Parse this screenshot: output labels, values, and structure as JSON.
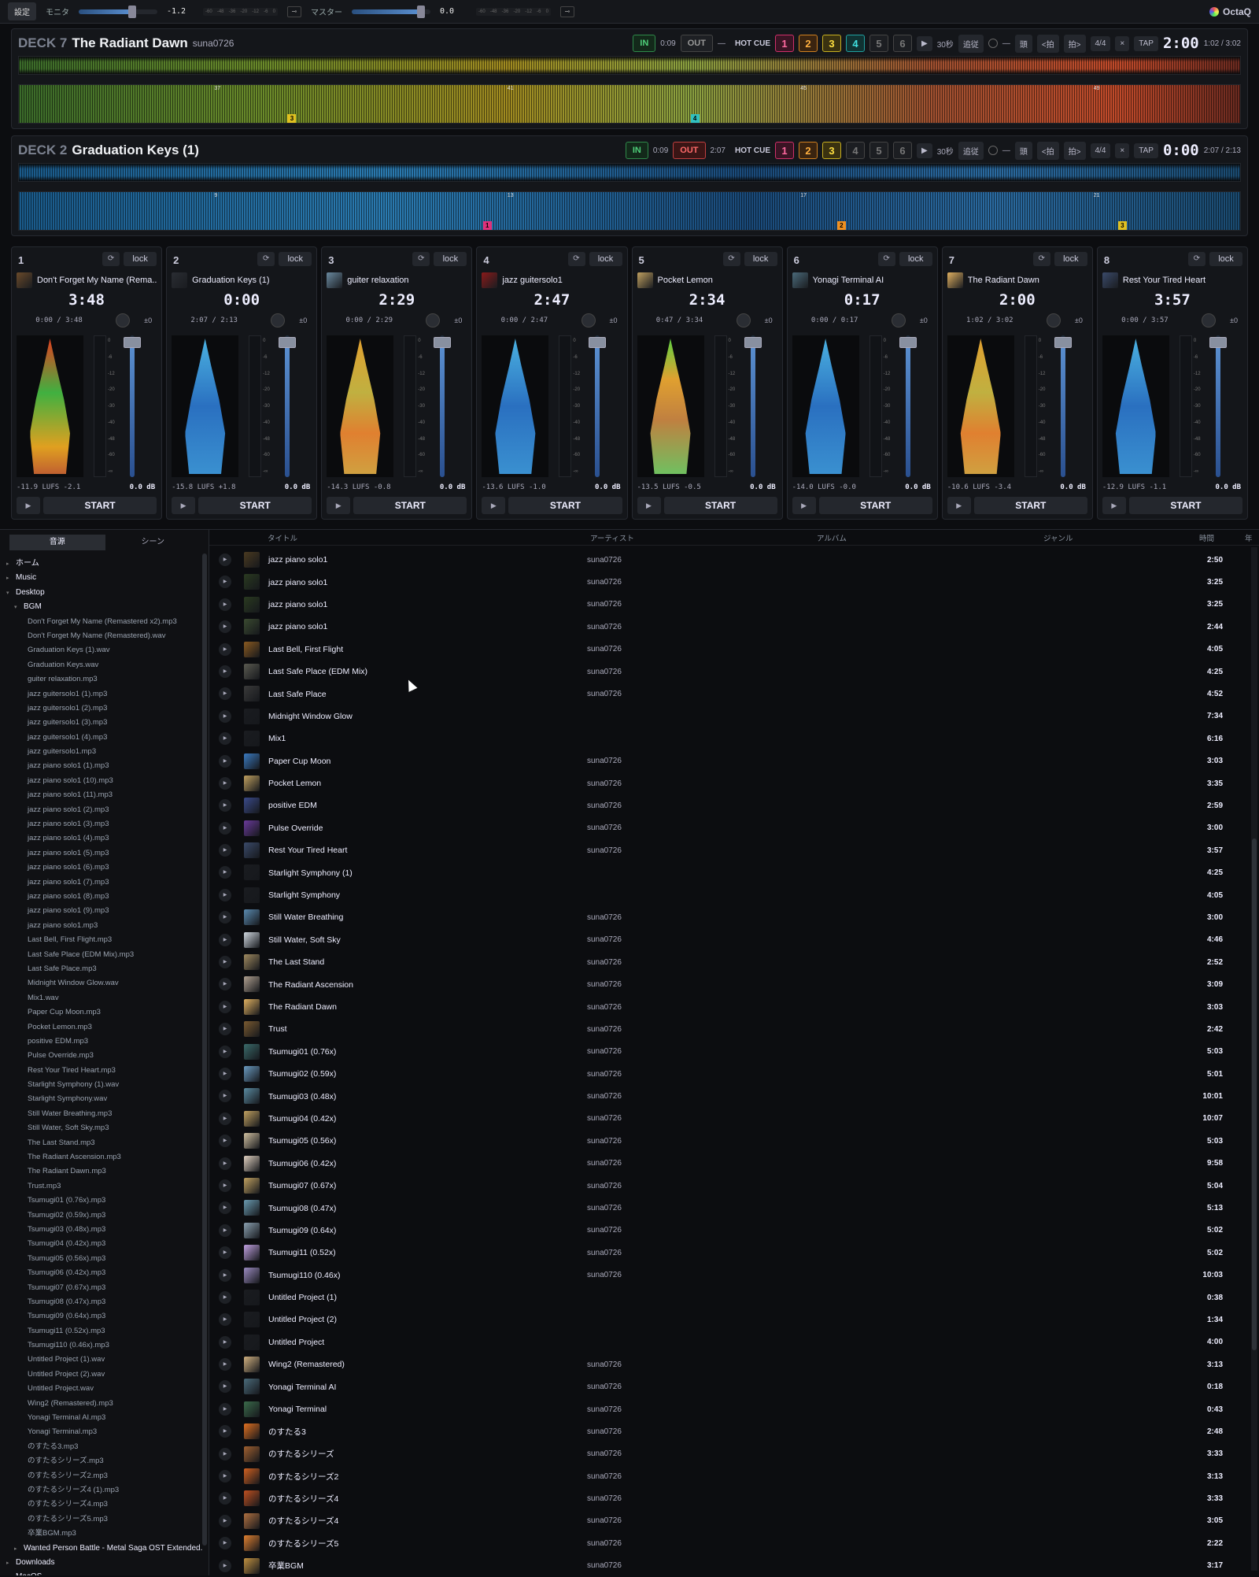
{
  "topbar": {
    "settings_label": "設定",
    "monitor_label": "モニタ",
    "monitor_value": "-1.2",
    "monitor_level": 0.68,
    "master_label": "マスター",
    "master_value": "0.0",
    "master_level": 0.88,
    "scale": [
      "-60",
      "-48",
      "-36",
      "-20",
      "-12",
      "-6",
      "0"
    ],
    "brand": "OctaQ"
  },
  "decks": [
    {
      "label": "DECK 7",
      "title": "The Radiant Dawn",
      "artist": "suna0726",
      "in_label": "IN",
      "in_time": "0:09",
      "out_label": "OUT",
      "out_active": false,
      "out_time": "",
      "dash": "—",
      "hotcue_label": "HOT CUE",
      "hotcues": [
        "1",
        "2",
        "3",
        "4",
        "5",
        "6"
      ],
      "hotcue_active": [
        true,
        true,
        true,
        true,
        false,
        false
      ],
      "play_icon": "▶",
      "skip_label": "30秒",
      "follow_label": "追従",
      "loop_dash": "—",
      "beat_label": "頭",
      "beat_back": "<拍",
      "beat_fwd": "拍>",
      "meter": "4/4",
      "close": "×",
      "tap": "TAP",
      "time": "2:00",
      "pos": "1:02 / 3:02",
      "palette": "warm",
      "cue_marks": [
        {
          "label": "3",
          "pos": 0.22,
          "color": "#e0c020"
        },
        {
          "label": "4",
          "pos": 0.55,
          "color": "#30c0c0"
        }
      ],
      "beat_numbers": [
        "37",
        "41",
        "45",
        "49"
      ]
    },
    {
      "label": "DECK 2",
      "title": "Graduation Keys (1)",
      "artist": "",
      "in_label": "IN",
      "in_time": "0:09",
      "out_label": "OUT",
      "out_active": true,
      "out_time": "2:07",
      "dash": "",
      "hotcue_label": "HOT CUE",
      "hotcues": [
        "1",
        "2",
        "3",
        "4",
        "5",
        "6"
      ],
      "hotcue_active": [
        true,
        true,
        true,
        false,
        false,
        false
      ],
      "play_icon": "▶",
      "skip_label": "30秒",
      "follow_label": "追従",
      "loop_dash": "—",
      "beat_label": "頭",
      "beat_back": "<拍",
      "beat_fwd": "拍>",
      "meter": "4/4",
      "close": "×",
      "tap": "TAP",
      "time": "0:00",
      "pos": "2:07 / 2:13",
      "palette": "cool",
      "cue_marks": [
        {
          "label": "1",
          "pos": 0.38,
          "color": "#e0307a"
        },
        {
          "label": "2",
          "pos": 0.67,
          "color": "#f09020"
        },
        {
          "label": "3",
          "pos": 0.9,
          "color": "#e0c020"
        }
      ],
      "beat_numbers": [
        "9",
        "13",
        "17",
        "21"
      ]
    }
  ],
  "channels": [
    {
      "num": "1",
      "sync": "⟳",
      "lock": "lock",
      "title": "Don't Forget My Name (Rema...",
      "time": "3:48",
      "pos": "0:00 / 3:48",
      "pm": "±0",
      "lufs": "-11.9 LUFS -2.1",
      "db": "0.0 dB",
      "play": "▶",
      "start": "START",
      "wave": "g",
      "thumb": "#6a4a2a"
    },
    {
      "num": "2",
      "sync": "⟳",
      "lock": "lock",
      "title": "Graduation Keys (1)",
      "time": "0:00",
      "pos": "2:07 / 2:13",
      "pm": "±0",
      "lufs": "-15.8 LUFS +1.8",
      "db": "0.0 dB",
      "play": "▶",
      "start": "START",
      "wave": "b",
      "thumb": "#2a2d33"
    },
    {
      "num": "3",
      "sync": "⟳",
      "lock": "lock",
      "title": "guiter relaxation",
      "time": "2:29",
      "pos": "0:00 / 2:29",
      "pm": "±0",
      "lufs": "-14.3 LUFS -0.8",
      "db": "0.0 dB",
      "play": "▶",
      "start": "START",
      "wave": "y",
      "thumb": "#6a8aa0"
    },
    {
      "num": "4",
      "sync": "⟳",
      "lock": "lock",
      "title": "jazz guitersolo1",
      "time": "2:47",
      "pos": "0:00 / 2:47",
      "pm": "±0",
      "lufs": "-13.6 LUFS -1.0",
      "db": "0.0 dB",
      "play": "▶",
      "start": "START",
      "wave": "b",
      "thumb": "#8a1a1a"
    },
    {
      "num": "5",
      "sync": "⟳",
      "lock": "lock",
      "title": "Pocket Lemon",
      "time": "2:34",
      "pos": "0:47 / 3:34",
      "pm": "±0",
      "lufs": "-13.5 LUFS -0.5",
      "db": "0.0 dB",
      "play": "▶",
      "start": "START",
      "wave": "m",
      "thumb": "#c0a060"
    },
    {
      "num": "6",
      "sync": "⟳",
      "lock": "lock",
      "title": "Yonagi Terminal AI",
      "time": "0:17",
      "pos": "0:00 / 0:17",
      "pm": "±0",
      "lufs": "-14.0 LUFS -0.0",
      "db": "0.0 dB",
      "play": "▶",
      "start": "START",
      "wave": "b",
      "thumb": "#4a6a7a"
    },
    {
      "num": "7",
      "sync": "⟳",
      "lock": "lock",
      "title": "The Radiant Dawn",
      "time": "2:00",
      "pos": "1:02 / 3:02",
      "pm": "±0",
      "lufs": "-10.6 LUFS -3.4",
      "db": "0.0 dB",
      "play": "▶",
      "start": "START",
      "wave": "y",
      "thumb": "#e0b060"
    },
    {
      "num": "8",
      "sync": "⟳",
      "lock": "lock",
      "title": "Rest Your Tired Heart",
      "time": "3:57",
      "pos": "0:00 / 3:57",
      "pm": "±0",
      "lufs": "-12.9 LUFS -1.1",
      "db": "0.0 dB",
      "play": "▶",
      "start": "START",
      "wave": "b",
      "thumb": "#3a4a6a"
    }
  ],
  "meter_scale": [
    "0",
    "-6",
    "-12",
    "-20",
    "-30",
    "-40",
    "-48",
    "-60",
    "-∞"
  ],
  "sidebar": {
    "tabs": [
      "音源",
      "シーン"
    ],
    "tree": [
      {
        "level": 0,
        "label": "ホーム",
        "arrow": "▸"
      },
      {
        "level": 0,
        "label": "Music",
        "arrow": "▸"
      },
      {
        "level": 0,
        "label": "Desktop",
        "arrow": "▾"
      },
      {
        "level": 1,
        "label": "BGM",
        "arrow": "▾"
      },
      {
        "level": 2,
        "label": "Don't Forget My Name (Remastered x2).mp3"
      },
      {
        "level": 2,
        "label": "Don't Forget My Name (Remastered).wav"
      },
      {
        "level": 2,
        "label": "Graduation Keys (1).wav"
      },
      {
        "level": 2,
        "label": "Graduation Keys.wav"
      },
      {
        "level": 2,
        "label": "guiter relaxation.mp3"
      },
      {
        "level": 2,
        "label": "jazz guitersolo1 (1).mp3"
      },
      {
        "level": 2,
        "label": "jazz guitersolo1 (2).mp3"
      },
      {
        "level": 2,
        "label": "jazz guitersolo1 (3).mp3"
      },
      {
        "level": 2,
        "label": "jazz guitersolo1 (4).mp3"
      },
      {
        "level": 2,
        "label": "jazz guitersolo1.mp3"
      },
      {
        "level": 2,
        "label": "jazz piano solo1 (1).mp3"
      },
      {
        "level": 2,
        "label": "jazz piano solo1 (10).mp3"
      },
      {
        "level": 2,
        "label": "jazz piano solo1 (11).mp3"
      },
      {
        "level": 2,
        "label": "jazz piano solo1 (2).mp3"
      },
      {
        "level": 2,
        "label": "jazz piano solo1 (3).mp3"
      },
      {
        "level": 2,
        "label": "jazz piano solo1 (4).mp3"
      },
      {
        "level": 2,
        "label": "jazz piano solo1 (5).mp3"
      },
      {
        "level": 2,
        "label": "jazz piano solo1 (6).mp3"
      },
      {
        "level": 2,
        "label": "jazz piano solo1 (7).mp3"
      },
      {
        "level": 2,
        "label": "jazz piano solo1 (8).mp3"
      },
      {
        "level": 2,
        "label": "jazz piano solo1 (9).mp3"
      },
      {
        "level": 2,
        "label": "jazz piano solo1.mp3"
      },
      {
        "level": 2,
        "label": "Last Bell, First Flight.mp3"
      },
      {
        "level": 2,
        "label": "Last Safe Place (EDM Mix).mp3"
      },
      {
        "level": 2,
        "label": "Last Safe Place.mp3"
      },
      {
        "level": 2,
        "label": "Midnight Window Glow.wav"
      },
      {
        "level": 2,
        "label": "Mix1.wav"
      },
      {
        "level": 2,
        "label": "Paper Cup Moon.mp3"
      },
      {
        "level": 2,
        "label": "Pocket Lemon.mp3"
      },
      {
        "level": 2,
        "label": "positive EDM.mp3"
      },
      {
        "level": 2,
        "label": "Pulse Override.mp3"
      },
      {
        "level": 2,
        "label": "Rest Your Tired Heart.mp3"
      },
      {
        "level": 2,
        "label": "Starlight Symphony (1).wav"
      },
      {
        "level": 2,
        "label": "Starlight Symphony.wav"
      },
      {
        "level": 2,
        "label": "Still Water Breathing.mp3"
      },
      {
        "level": 2,
        "label": "Still Water, Soft Sky.mp3"
      },
      {
        "level": 2,
        "label": "The Last Stand.mp3"
      },
      {
        "level": 2,
        "label": "The Radiant Ascension.mp3"
      },
      {
        "level": 2,
        "label": "The Radiant Dawn.mp3"
      },
      {
        "level": 2,
        "label": "Trust.mp3"
      },
      {
        "level": 2,
        "label": "Tsumugi01 (0.76x).mp3"
      },
      {
        "level": 2,
        "label": "Tsumugi02 (0.59x).mp3"
      },
      {
        "level": 2,
        "label": "Tsumugi03 (0.48x).mp3"
      },
      {
        "level": 2,
        "label": "Tsumugi04 (0.42x).mp3"
      },
      {
        "level": 2,
        "label": "Tsumugi05 (0.56x).mp3"
      },
      {
        "level": 2,
        "label": "Tsumugi06 (0.42x).mp3"
      },
      {
        "level": 2,
        "label": "Tsumugi07 (0.67x).mp3"
      },
      {
        "level": 2,
        "label": "Tsumugi08 (0.47x).mp3"
      },
      {
        "level": 2,
        "label": "Tsumugi09 (0.64x).mp3"
      },
      {
        "level": 2,
        "label": "Tsumugi11 (0.52x).mp3"
      },
      {
        "level": 2,
        "label": "Tsumugi110 (0.46x).mp3"
      },
      {
        "level": 2,
        "label": "Untitled Project (1).wav"
      },
      {
        "level": 2,
        "label": "Untitled Project (2).wav"
      },
      {
        "level": 2,
        "label": "Untitled Project.wav"
      },
      {
        "level": 2,
        "label": "Wing2 (Remastered).mp3"
      },
      {
        "level": 2,
        "label": "Yonagi Terminal AI.mp3"
      },
      {
        "level": 2,
        "label": "Yonagi Terminal.mp3"
      },
      {
        "level": 2,
        "label": "のすたる3.mp3"
      },
      {
        "level": 2,
        "label": "のすたるシリーズ.mp3"
      },
      {
        "level": 2,
        "label": "のすたるシリーズ2.mp3"
      },
      {
        "level": 2,
        "label": "のすたるシリーズ4 (1).mp3"
      },
      {
        "level": 2,
        "label": "のすたるシリーズ4.mp3"
      },
      {
        "level": 2,
        "label": "のすたるシリーズ5.mp3"
      },
      {
        "level": 2,
        "label": "卒業BGM.mp3"
      },
      {
        "level": 1,
        "label": "Wanted Person Battle - Metal Saga OST Extended...",
        "arrow": "▸"
      },
      {
        "level": 0,
        "label": "Downloads",
        "arrow": "▸"
      },
      {
        "level": 0,
        "label": "MacOS",
        "arrow": "▸"
      }
    ]
  },
  "table": {
    "headers": {
      "title": "タイトル",
      "artist": "アーティスト",
      "album": "アルバム",
      "genre": "ジャンル",
      "time": "時間",
      "year": "年"
    },
    "rows": [
      {
        "title": "jazz piano solo1",
        "artist": "suna0726",
        "time": "2:50",
        "thumb": "#4a3a20"
      },
      {
        "title": "jazz piano solo1",
        "artist": "suna0726",
        "time": "3:25",
        "thumb": "#2a3a20"
      },
      {
        "title": "jazz piano solo1",
        "artist": "suna0726",
        "time": "3:25",
        "thumb": "#2a3a20"
      },
      {
        "title": "jazz piano solo1",
        "artist": "suna0726",
        "time": "2:44",
        "thumb": "#3a4a30"
      },
      {
        "title": "Last Bell, First Flight",
        "artist": "suna0726",
        "time": "4:05",
        "thumb": "#8a5a20"
      },
      {
        "title": "Last Safe Place (EDM Mix)",
        "artist": "suna0726",
        "time": "4:25",
        "thumb": "#5a5a50"
      },
      {
        "title": "Last Safe Place",
        "artist": "suna0726",
        "time": "4:52",
        "thumb": "#3a3a3a"
      },
      {
        "title": "Midnight Window Glow",
        "artist": "",
        "time": "7:34",
        "thumb": "#1a1c20"
      },
      {
        "title": "Mix1",
        "artist": "",
        "time": "6:16",
        "thumb": "#1a1c20"
      },
      {
        "title": "Paper Cup Moon",
        "artist": "suna0726",
        "time": "3:03",
        "thumb": "#3a7ac0"
      },
      {
        "title": "Pocket Lemon",
        "artist": "suna0726",
        "time": "3:35",
        "thumb": "#c0a060"
      },
      {
        "title": "positive EDM",
        "artist": "suna0726",
        "time": "2:59",
        "thumb": "#3a4a8a"
      },
      {
        "title": "Pulse Override",
        "artist": "suna0726",
        "time": "3:00",
        "thumb": "#6a3a9a"
      },
      {
        "title": "Rest Your Tired Heart",
        "artist": "suna0726",
        "time": "3:57",
        "thumb": "#3a4a6a"
      },
      {
        "title": "Starlight Symphony (1)",
        "artist": "",
        "time": "4:25",
        "thumb": "#1a1c20"
      },
      {
        "title": "Starlight Symphony",
        "artist": "",
        "time": "4:05",
        "thumb": "#1a1c20"
      },
      {
        "title": "Still Water Breathing",
        "artist": "suna0726",
        "time": "3:00",
        "thumb": "#5a8ab0"
      },
      {
        "title": "Still Water, Soft Sky",
        "artist": "suna0726",
        "time": "4:46",
        "thumb": "#d0d8e0"
      },
      {
        "title": "The Last Stand",
        "artist": "suna0726",
        "time": "2:52",
        "thumb": "#a08a60"
      },
      {
        "title": "The Radiant Ascension",
        "artist": "suna0726",
        "time": "3:09",
        "thumb": "#b0a090"
      },
      {
        "title": "The Radiant Dawn",
        "artist": "suna0726",
        "time": "3:03",
        "thumb": "#e0b060"
      },
      {
        "title": "Trust",
        "artist": "suna0726",
        "time": "2:42",
        "thumb": "#7a5a30"
      },
      {
        "title": "Tsumugi01 (0.76x)",
        "artist": "suna0726",
        "time": "5:03",
        "thumb": "#3a6a6a"
      },
      {
        "title": "Tsumugi02 (0.59x)",
        "artist": "suna0726",
        "time": "5:01",
        "thumb": "#6a9ac0"
      },
      {
        "title": "Tsumugi03 (0.48x)",
        "artist": "suna0726",
        "time": "10:01",
        "thumb": "#5a8aa0"
      },
      {
        "title": "Tsumugi04 (0.42x)",
        "artist": "suna0726",
        "time": "10:07",
        "thumb": "#c0a060"
      },
      {
        "title": "Tsumugi05 (0.56x)",
        "artist": "suna0726",
        "time": "5:03",
        "thumb": "#d0c0a0"
      },
      {
        "title": "Tsumugi06 (0.42x)",
        "artist": "suna0726",
        "time": "9:58",
        "thumb": "#e0d0c0"
      },
      {
        "title": "Tsumugi07 (0.67x)",
        "artist": "suna0726",
        "time": "5:04",
        "thumb": "#c0a060"
      },
      {
        "title": "Tsumugi08 (0.47x)",
        "artist": "suna0726",
        "time": "5:13",
        "thumb": "#6a9ab0"
      },
      {
        "title": "Tsumugi09 (0.64x)",
        "artist": "suna0726",
        "time": "5:02",
        "thumb": "#8aa0b0"
      },
      {
        "title": "Tsumugi11 (0.52x)",
        "artist": "suna0726",
        "time": "5:02",
        "thumb": "#c0a0e0"
      },
      {
        "title": "Tsumugi110 (0.46x)",
        "artist": "suna0726",
        "time": "10:03",
        "thumb": "#9a8ac0"
      },
      {
        "title": "Untitled Project (1)",
        "artist": "",
        "time": "0:38",
        "thumb": "#1a1c20"
      },
      {
        "title": "Untitled Project (2)",
        "artist": "",
        "time": "1:34",
        "thumb": "#1a1c20"
      },
      {
        "title": "Untitled Project",
        "artist": "",
        "time": "4:00",
        "thumb": "#1a1c20"
      },
      {
        "title": "Wing2 (Remastered)",
        "artist": "suna0726",
        "time": "3:13",
        "thumb": "#d0b080"
      },
      {
        "title": "Yonagi Terminal AI",
        "artist": "suna0726",
        "time": "0:18",
        "thumb": "#4a6a7a"
      },
      {
        "title": "Yonagi Terminal",
        "artist": "suna0726",
        "time": "0:43",
        "thumb": "#3a6a4a"
      },
      {
        "title": "のすたる3",
        "artist": "suna0726",
        "time": "2:48",
        "thumb": "#e07020"
      },
      {
        "title": "のすたるシリーズ",
        "artist": "suna0726",
        "time": "3:33",
        "thumb": "#a06030"
      },
      {
        "title": "のすたるシリーズ2",
        "artist": "suna0726",
        "time": "3:13",
        "thumb": "#d06020"
      },
      {
        "title": "のすたるシリーズ4",
        "artist": "suna0726",
        "time": "3:33",
        "thumb": "#c05020"
      },
      {
        "title": "のすたるシリーズ4",
        "artist": "suna0726",
        "time": "3:05",
        "thumb": "#b07040"
      },
      {
        "title": "のすたるシリーズ5",
        "artist": "suna0726",
        "time": "2:22",
        "thumb": "#e08030"
      },
      {
        "title": "卒業BGM",
        "artist": "suna0726",
        "time": "3:17",
        "thumb": "#c09040"
      }
    ]
  }
}
